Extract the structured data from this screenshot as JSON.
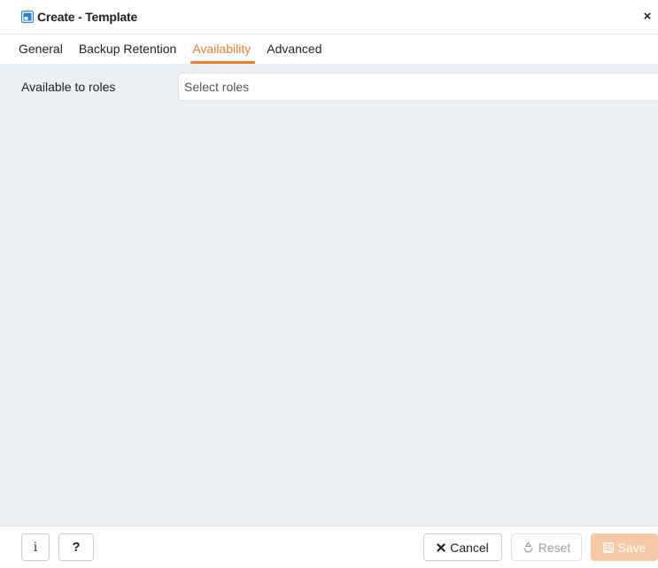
{
  "dialog": {
    "title": "Create - Template",
    "close_glyph": "×",
    "title_icon": "window-icon",
    "accent_color": "#ec7f2f"
  },
  "tabs": [
    {
      "label": "General",
      "active": false
    },
    {
      "label": "Backup Retention",
      "active": false
    },
    {
      "label": "Availability",
      "active": true
    },
    {
      "label": "Advanced",
      "active": false
    }
  ],
  "form": {
    "roles_label": "Available to roles",
    "roles_placeholder": "Select roles"
  },
  "footer": {
    "info_glyph": "i",
    "help_glyph": "?",
    "cancel_label": "Cancel",
    "reset_label": "Reset",
    "save_label": "Save"
  }
}
